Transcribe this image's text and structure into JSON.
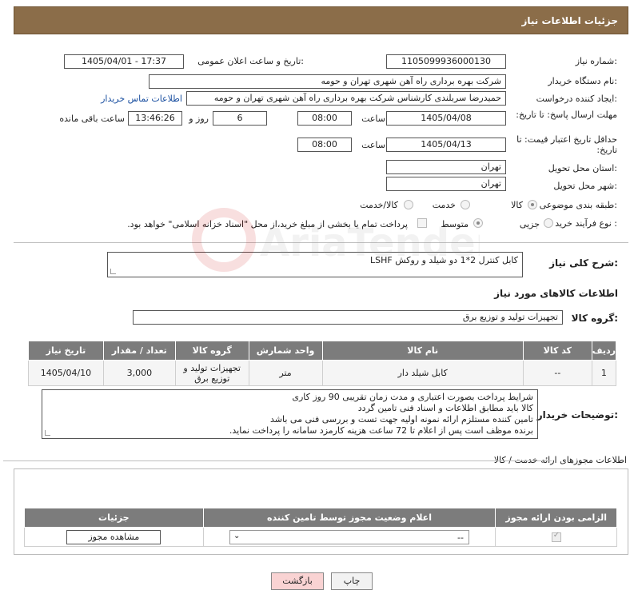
{
  "header": {
    "title": "جزئیات اطلاعات نیاز"
  },
  "form": {
    "need_number_label": "شماره نیاز:",
    "need_number": "1105099936000130",
    "announce_label": "تاریخ و ساعت اعلان عمومی:",
    "announce_value": "1405/04/01 - 17:37",
    "buyer_org_label": "نام دستگاه خریدار:",
    "buyer_org": "شرکت بهره برداری راه آهن شهری تهران و حومه",
    "creator_label": "ایجاد کننده درخواست:",
    "creator": "حمیدرضا سربلندی کارشناس شرکت بهره برداری راه آهن شهری تهران و حومه",
    "contact_link": "اطلاعات تماس خریدار",
    "reply_deadline_label": "مهلت ارسال پاسخ: تا تاریخ:",
    "reply_date": "1405/04/08",
    "time_label": "ساعت",
    "reply_time": "08:00",
    "days_value": "6",
    "days_label": "روز و",
    "remaining_time": "13:46:26",
    "remaining_label": "ساعت باقی مانده",
    "price_validity_label": "حداقل تاریخ اعتبار قیمت: تا تاریخ:",
    "validity_date": "1405/04/13",
    "validity_time": "08:00",
    "province_label": "استان محل تحویل:",
    "province": "تهران",
    "city_label": "شهر محل تحویل:",
    "city": "تهران",
    "category_label": "طبقه بندی موضوعی:",
    "category_options": [
      "کالا",
      "خدمت",
      "کالا/خدمت"
    ],
    "process_label": "نوع فرآیند خرید :",
    "process_options": [
      "جزیی",
      "متوسط"
    ],
    "payment_text": "پرداخت تمام یا بخشی از مبلغ خرید،از محل \"اسناد خزانه اسلامی\" خواهد بود."
  },
  "summary": {
    "label": "شرح کلی نیاز:",
    "value": "کابل کنترل 2*1 دو شیلد و روکش LSHF"
  },
  "goods": {
    "title": "اطلاعات کالاهای مورد نیاز",
    "group_label": "گروه کالا:",
    "group_value": "تجهیزات تولید و توزیع برق",
    "columns": [
      "ردیف",
      "کد کالا",
      "نام کالا",
      "واحد شمارش",
      "گروه کالا",
      "تعداد / مقدار",
      "تاریخ نیاز"
    ],
    "rows": [
      {
        "row": "1",
        "code": "--",
        "name": "کابل شیلد دار",
        "unit": "متر",
        "group_line1": "تجهیزات تولید و",
        "group_line2": "توزیع برق",
        "qty": "3,000",
        "date": "1405/04/10"
      }
    ]
  },
  "buyer_notes": {
    "label": "توضیحات خریدار:",
    "lines": [
      "شرایط پرداخت بصورت اعتباری و مدت زمان تقریبی 90 روز کاری",
      "کالا باید مطابق اطلاعات و اسناد فنی تامین گردد",
      "تامین کننده مستلزم ارائه نمونه اولیه جهت تست و بررسی فنی می باشد",
      "برنده موظف است پس از اعلام  تا 72 ساعت هزینه کارمزد سامانه را پرداخت نماید."
    ]
  },
  "permits": {
    "title": "اطلاعات مجوزهای ارائه خدمت / کالا",
    "columns": [
      "الزامی بودن ارائه مجوز",
      "اعلام وضعیت مجوز توسط تامین کننده",
      "جزئیات"
    ],
    "select_value": "--",
    "view_button": "مشاهده مجوز"
  },
  "buttons": {
    "print": "چاپ",
    "back": "بازگشت"
  },
  "watermark": {
    "text": "AriaTender.neT"
  },
  "colors": {
    "header_bg": "#8b6d49",
    "table_header_bg": "#7c7c7c",
    "back_button_bg": "#f9d3d3",
    "link": "#1a4fa0"
  }
}
